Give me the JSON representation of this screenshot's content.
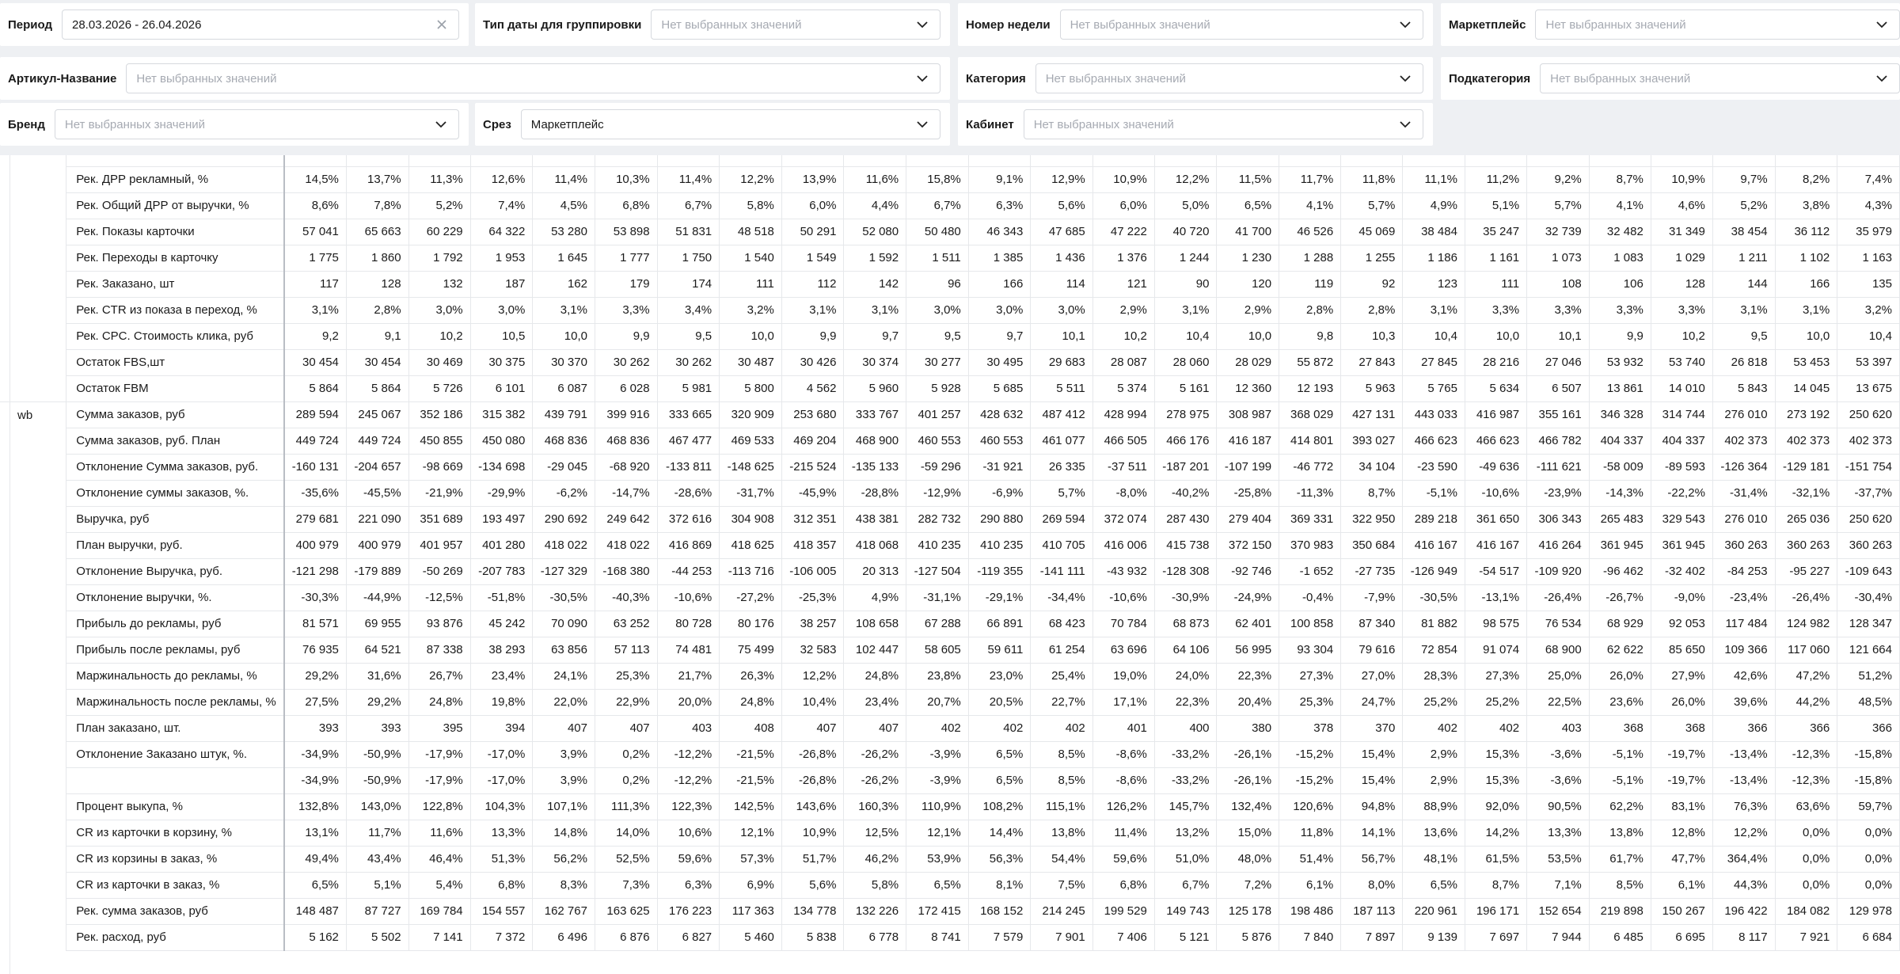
{
  "filters": {
    "period": {
      "label": "Период",
      "value": "28.03.2026 - 26.04.2026"
    },
    "date_type": {
      "label": "Тип даты для группировки",
      "placeholder": "Нет выбранных значений"
    },
    "week_number": {
      "label": "Номер недели",
      "placeholder": "Нет выбранных значений"
    },
    "marketplace": {
      "label": "Маркетплейс",
      "placeholder": "Нет выбранных значений"
    },
    "article": {
      "label": "Артикул-Название",
      "placeholder": "Нет выбранных значений"
    },
    "category": {
      "label": "Категория",
      "placeholder": "Нет выбранных значений"
    },
    "subcategory": {
      "label": "Подкатегория",
      "placeholder": "Нет выбранных значений"
    },
    "brand": {
      "label": "Бренд",
      "placeholder": "Нет выбранных значений"
    },
    "slice": {
      "label": "Срез",
      "value": "Маркетплейс"
    },
    "cabinet": {
      "label": "Кабинет",
      "placeholder": "Нет выбранных значений"
    }
  },
  "icons": {
    "clear": "close-icon",
    "dropdown": "chevron-down-icon"
  },
  "table": {
    "rows": [
      {
        "group": "",
        "name": "Рек. ДРР рекламный, %",
        "values": [
          "14,5%",
          "13,7%",
          "11,3%",
          "12,6%",
          "11,4%",
          "10,3%",
          "11,4%",
          "12,2%",
          "13,9%",
          "11,6%",
          "15,8%",
          "9,1%",
          "12,9%",
          "10,9%",
          "12,2%",
          "11,5%",
          "11,7%",
          "11,8%",
          "11,1%",
          "11,2%",
          "9,2%",
          "8,7%",
          "10,9%",
          "9,7%",
          "8,2%",
          "7,4%"
        ]
      },
      {
        "group": "",
        "name": "Рек. Общий ДРР от выручки, %",
        "values": [
          "8,6%",
          "7,8%",
          "5,2%",
          "7,4%",
          "4,5%",
          "6,8%",
          "6,7%",
          "5,8%",
          "6,0%",
          "4,4%",
          "6,7%",
          "6,3%",
          "5,6%",
          "6,0%",
          "5,0%",
          "6,5%",
          "4,1%",
          "5,7%",
          "4,9%",
          "5,1%",
          "5,7%",
          "4,1%",
          "4,6%",
          "5,2%",
          "3,8%",
          "4,3%"
        ]
      },
      {
        "group": "",
        "name": "Рек. Показы карточки",
        "values": [
          "57 041",
          "65 663",
          "60 229",
          "64 322",
          "53 280",
          "53 898",
          "51 831",
          "48 518",
          "50 291",
          "52 080",
          "50 480",
          "46 343",
          "47 685",
          "47 222",
          "40 720",
          "41 700",
          "46 526",
          "45 069",
          "38 484",
          "35 247",
          "32 739",
          "32 482",
          "31 349",
          "38 454",
          "36 112",
          "35 979"
        ]
      },
      {
        "group": "",
        "name": "Рек. Переходы в карточку",
        "values": [
          "1 775",
          "1 860",
          "1 792",
          "1 953",
          "1 645",
          "1 777",
          "1 750",
          "1 540",
          "1 549",
          "1 592",
          "1 511",
          "1 385",
          "1 436",
          "1 376",
          "1 244",
          "1 230",
          "1 288",
          "1 255",
          "1 186",
          "1 161",
          "1 073",
          "1 083",
          "1 029",
          "1 211",
          "1 102",
          "1 163"
        ]
      },
      {
        "group": "",
        "name": "Рек. Заказано, шт",
        "values": [
          "117",
          "128",
          "132",
          "187",
          "162",
          "179",
          "174",
          "111",
          "112",
          "142",
          "96",
          "166",
          "114",
          "121",
          "90",
          "120",
          "119",
          "92",
          "123",
          "111",
          "108",
          "106",
          "128",
          "144",
          "166",
          "135"
        ]
      },
      {
        "group": "",
        "name": "Рек. CTR из показа в переход, %",
        "values": [
          "3,1%",
          "2,8%",
          "3,0%",
          "3,0%",
          "3,1%",
          "3,3%",
          "3,4%",
          "3,2%",
          "3,1%",
          "3,1%",
          "3,0%",
          "3,0%",
          "3,0%",
          "2,9%",
          "3,1%",
          "2,9%",
          "2,8%",
          "2,8%",
          "3,1%",
          "3,3%",
          "3,3%",
          "3,3%",
          "3,3%",
          "3,1%",
          "3,1%",
          "3,2%"
        ]
      },
      {
        "group": "",
        "name": "Рек. CPC. Стоимость клика, руб",
        "values": [
          "9,2",
          "9,1",
          "10,2",
          "10,5",
          "10,0",
          "9,9",
          "9,5",
          "10,0",
          "9,9",
          "9,7",
          "9,5",
          "9,7",
          "10,1",
          "10,2",
          "10,4",
          "10,0",
          "9,8",
          "10,3",
          "10,4",
          "10,0",
          "10,1",
          "9,9",
          "10,2",
          "9,5",
          "10,0",
          "10,4"
        ]
      },
      {
        "group": "",
        "name": "Остаток FBS,шт",
        "values": [
          "30 454",
          "30 454",
          "30 469",
          "30 375",
          "30 370",
          "30 262",
          "30 262",
          "30 487",
          "30 426",
          "30 374",
          "30 277",
          "30 495",
          "29 683",
          "28 087",
          "28 060",
          "28 029",
          "55 872",
          "27 843",
          "27 845",
          "28 216",
          "27 046",
          "53 932",
          "53 740",
          "26 818",
          "53 453",
          "53 397"
        ]
      },
      {
        "group": "",
        "name": "Остаток FBM",
        "values": [
          "5 864",
          "5 864",
          "5 726",
          "6 101",
          "6 087",
          "6 028",
          "5 981",
          "5 800",
          "4 562",
          "5 960",
          "5 928",
          "5 685",
          "5 511",
          "5 374",
          "5 161",
          "12 360",
          "12 193",
          "5 963",
          "5 765",
          "5 634",
          "6 507",
          "13 861",
          "14 010",
          "5 843",
          "14 045",
          "13 675"
        ]
      },
      {
        "group": "wb",
        "name": "Сумма заказов, руб",
        "values": [
          "289 594",
          "245 067",
          "352 186",
          "315 382",
          "439 791",
          "399 916",
          "333 665",
          "320 909",
          "253 680",
          "333 767",
          "401 257",
          "428 632",
          "487 412",
          "428 994",
          "278 975",
          "308 987",
          "368 029",
          "427 131",
          "443 033",
          "416 987",
          "355 161",
          "346 328",
          "314 744",
          "276 010",
          "273 192",
          "250 620"
        ]
      },
      {
        "group": "",
        "name": "Сумма заказов, руб. План",
        "values": [
          "449 724",
          "449 724",
          "450 855",
          "450 080",
          "468 836",
          "468 836",
          "467 477",
          "469 533",
          "469 204",
          "468 900",
          "460 553",
          "460 553",
          "461 077",
          "466 505",
          "466 176",
          "416 187",
          "414 801",
          "393 027",
          "466 623",
          "466 623",
          "466 782",
          "404 337",
          "404 337",
          "402 373",
          "402 373",
          "402 373"
        ]
      },
      {
        "group": "",
        "name": "Отклонение Сумма заказов, руб.",
        "values": [
          "-160 131",
          "-204 657",
          "-98 669",
          "-134 698",
          "-29 045",
          "-68 920",
          "-133 811",
          "-148 625",
          "-215 524",
          "-135 133",
          "-59 296",
          "-31 921",
          "26 335",
          "-37 511",
          "-187 201",
          "-107 199",
          "-46 772",
          "34 104",
          "-23 590",
          "-49 636",
          "-111 621",
          "-58 009",
          "-89 593",
          "-126 364",
          "-129 181",
          "-151 754"
        ]
      },
      {
        "group": "",
        "name": "Отклонение суммы заказов, %.",
        "values": [
          "-35,6%",
          "-45,5%",
          "-21,9%",
          "-29,9%",
          "-6,2%",
          "-14,7%",
          "-28,6%",
          "-31,7%",
          "-45,9%",
          "-28,8%",
          "-12,9%",
          "-6,9%",
          "5,7%",
          "-8,0%",
          "-40,2%",
          "-25,8%",
          "-11,3%",
          "8,7%",
          "-5,1%",
          "-10,6%",
          "-23,9%",
          "-14,3%",
          "-22,2%",
          "-31,4%",
          "-32,1%",
          "-37,7%"
        ]
      },
      {
        "group": "",
        "name": "Выручка, руб",
        "values": [
          "279 681",
          "221 090",
          "351 689",
          "193 497",
          "290 692",
          "249 642",
          "372 616",
          "304 908",
          "312 351",
          "438 381",
          "282 732",
          "290 880",
          "269 594",
          "372 074",
          "287 430",
          "279 404",
          "369 331",
          "322 950",
          "289 218",
          "361 650",
          "306 343",
          "265 483",
          "329 543",
          "276 010",
          "265 036",
          "250 620"
        ]
      },
      {
        "group": "",
        "name": "План выручки, руб.",
        "values": [
          "400 979",
          "400 979",
          "401 957",
          "401 280",
          "418 022",
          "418 022",
          "416 869",
          "418 625",
          "418 357",
          "418 068",
          "410 235",
          "410 235",
          "410 705",
          "416 006",
          "415 738",
          "372 150",
          "370 983",
          "350 684",
          "416 167",
          "416 167",
          "416 264",
          "361 945",
          "361 945",
          "360 263",
          "360 263",
          "360 263"
        ]
      },
      {
        "group": "",
        "name": "Отклонение Выручка, руб.",
        "values": [
          "-121 298",
          "-179 889",
          "-50 269",
          "-207 783",
          "-127 329",
          "-168 380",
          "-44 253",
          "-113 716",
          "-106 005",
          "20 313",
          "-127 504",
          "-119 355",
          "-141 111",
          "-43 932",
          "-128 308",
          "-92 746",
          "-1 652",
          "-27 735",
          "-126 949",
          "-54 517",
          "-109 920",
          "-96 462",
          "-32 402",
          "-84 253",
          "-95 227",
          "-109 643"
        ]
      },
      {
        "group": "",
        "name": "Отклонение выручки, %.",
        "values": [
          "-30,3%",
          "-44,9%",
          "-12,5%",
          "-51,8%",
          "-30,5%",
          "-40,3%",
          "-10,6%",
          "-27,2%",
          "-25,3%",
          "4,9%",
          "-31,1%",
          "-29,1%",
          "-34,4%",
          "-10,6%",
          "-30,9%",
          "-24,9%",
          "-0,4%",
          "-7,9%",
          "-30,5%",
          "-13,1%",
          "-26,4%",
          "-26,7%",
          "-9,0%",
          "-23,4%",
          "-26,4%",
          "-30,4%"
        ]
      },
      {
        "group": "",
        "name": "Прибыль до рекламы, руб",
        "values": [
          "81 571",
          "69 955",
          "93 876",
          "45 242",
          "70 090",
          "63 252",
          "80 728",
          "80 176",
          "38 257",
          "108 658",
          "67 288",
          "66 891",
          "68 423",
          "70 784",
          "68 873",
          "62 401",
          "100 858",
          "87 340",
          "81 882",
          "98 575",
          "76 534",
          "68 929",
          "92 053",
          "117 484",
          "124 982",
          "128 347"
        ]
      },
      {
        "group": "",
        "name": "Прибыль после рекламы, руб",
        "values": [
          "76 935",
          "64 521",
          "87 338",
          "38 293",
          "63 856",
          "57 113",
          "74 481",
          "75 499",
          "32 583",
          "102 447",
          "58 605",
          "59 611",
          "61 254",
          "63 696",
          "64 106",
          "56 995",
          "93 304",
          "79 616",
          "72 854",
          "91 074",
          "68 900",
          "62 622",
          "85 650",
          "109 366",
          "117 060",
          "121 664"
        ]
      },
      {
        "group": "",
        "name": "Маржинальность до рекламы, %",
        "values": [
          "29,2%",
          "31,6%",
          "26,7%",
          "23,4%",
          "24,1%",
          "25,3%",
          "21,7%",
          "26,3%",
          "12,2%",
          "24,8%",
          "23,8%",
          "23,0%",
          "25,4%",
          "19,0%",
          "24,0%",
          "22,3%",
          "27,3%",
          "27,0%",
          "28,3%",
          "27,3%",
          "25,0%",
          "26,0%",
          "27,9%",
          "42,6%",
          "47,2%",
          "51,2%"
        ]
      },
      {
        "group": "",
        "name": "Маржинальность после рекламы, %",
        "values": [
          "27,5%",
          "29,2%",
          "24,8%",
          "19,8%",
          "22,0%",
          "22,9%",
          "20,0%",
          "24,8%",
          "10,4%",
          "23,4%",
          "20,7%",
          "20,5%",
          "22,7%",
          "17,1%",
          "22,3%",
          "20,4%",
          "25,3%",
          "24,7%",
          "25,2%",
          "25,2%",
          "22,5%",
          "23,6%",
          "26,0%",
          "39,6%",
          "44,2%",
          "48,5%"
        ]
      },
      {
        "group": "",
        "name": "План заказано, шт.",
        "values": [
          "393",
          "393",
          "395",
          "394",
          "407",
          "407",
          "403",
          "408",
          "407",
          "407",
          "402",
          "402",
          "402",
          "401",
          "400",
          "380",
          "378",
          "370",
          "402",
          "402",
          "403",
          "368",
          "368",
          "366",
          "366",
          "366"
        ]
      },
      {
        "group": "",
        "name": "Отклонение Заказано штук, %.",
        "values": [
          "-34,9%",
          "-50,9%",
          "-17,9%",
          "-17,0%",
          "3,9%",
          "0,2%",
          "-12,2%",
          "-21,5%",
          "-26,8%",
          "-26,2%",
          "-3,9%",
          "6,5%",
          "8,5%",
          "-8,6%",
          "-33,2%",
          "-26,1%",
          "-15,2%",
          "15,4%",
          "2,9%",
          "15,3%",
          "-3,6%",
          "-5,1%",
          "-19,7%",
          "-13,4%",
          "-12,3%",
          "-15,8%"
        ]
      },
      {
        "group": "",
        "name": "",
        "values": [
          "-34,9%",
          "-50,9%",
          "-17,9%",
          "-17,0%",
          "3,9%",
          "0,2%",
          "-12,2%",
          "-21,5%",
          "-26,8%",
          "-26,2%",
          "-3,9%",
          "6,5%",
          "8,5%",
          "-8,6%",
          "-33,2%",
          "-26,1%",
          "-15,2%",
          "15,4%",
          "2,9%",
          "15,3%",
          "-3,6%",
          "-5,1%",
          "-19,7%",
          "-13,4%",
          "-12,3%",
          "-15,8%"
        ]
      },
      {
        "group": "",
        "name": "Процент выкупа, %",
        "values": [
          "132,8%",
          "143,0%",
          "122,8%",
          "104,3%",
          "107,1%",
          "111,3%",
          "122,3%",
          "142,5%",
          "143,6%",
          "160,3%",
          "110,9%",
          "108,2%",
          "115,1%",
          "126,2%",
          "145,7%",
          "132,4%",
          "120,6%",
          "94,8%",
          "88,9%",
          "92,0%",
          "90,5%",
          "62,2%",
          "83,1%",
          "76,3%",
          "63,6%",
          "59,7%"
        ]
      },
      {
        "group": "",
        "name": "CR из карточки в корзину, %",
        "values": [
          "13,1%",
          "11,7%",
          "11,6%",
          "13,3%",
          "14,8%",
          "14,0%",
          "10,6%",
          "12,1%",
          "10,9%",
          "12,5%",
          "12,1%",
          "14,4%",
          "13,8%",
          "11,4%",
          "13,2%",
          "15,0%",
          "11,8%",
          "14,1%",
          "13,6%",
          "14,2%",
          "13,3%",
          "13,8%",
          "12,8%",
          "12,2%",
          "0,0%",
          "0,0%"
        ]
      },
      {
        "group": "",
        "name": "CR из корзины в заказ, %",
        "values": [
          "49,4%",
          "43,4%",
          "46,4%",
          "51,3%",
          "56,2%",
          "52,5%",
          "59,6%",
          "57,3%",
          "51,7%",
          "46,2%",
          "53,9%",
          "56,3%",
          "54,4%",
          "59,6%",
          "51,0%",
          "48,0%",
          "51,4%",
          "56,7%",
          "48,1%",
          "61,5%",
          "53,5%",
          "61,7%",
          "47,7%",
          "364,4%",
          "0,0%",
          "0,0%"
        ]
      },
      {
        "group": "",
        "name": "CR из карточки в заказ, %",
        "values": [
          "6,5%",
          "5,1%",
          "5,4%",
          "6,8%",
          "8,3%",
          "7,3%",
          "6,3%",
          "6,9%",
          "5,6%",
          "5,8%",
          "6,5%",
          "8,1%",
          "7,5%",
          "6,8%",
          "6,7%",
          "7,2%",
          "6,1%",
          "8,0%",
          "6,5%",
          "8,7%",
          "7,1%",
          "8,5%",
          "6,1%",
          "44,3%",
          "0,0%",
          "0,0%"
        ]
      },
      {
        "group": "",
        "name": "Рек. сумма заказов, руб",
        "values": [
          "148 487",
          "87 727",
          "169 784",
          "154 557",
          "162 767",
          "163 625",
          "176 223",
          "117 363",
          "134 778",
          "132 226",
          "172 415",
          "168 152",
          "214 245",
          "199 529",
          "149 743",
          "125 178",
          "198 486",
          "187 113",
          "220 961",
          "196 171",
          "152 654",
          "219 898",
          "150 267",
          "196 422",
          "184 082",
          "129 978"
        ]
      },
      {
        "group": "",
        "name": "Рек. расход, руб",
        "values": [
          "5 162",
          "5 502",
          "7 141",
          "7 372",
          "6 496",
          "6 876",
          "6 827",
          "5 460",
          "5 838",
          "6 778",
          "8 741",
          "7 579",
          "7 901",
          "7 406",
          "5 121",
          "5 876",
          "7 840",
          "7 897",
          "9 139",
          "7 697",
          "7 944",
          "6 485",
          "6 695",
          "8 117",
          "7 921",
          "6 684"
        ]
      }
    ]
  }
}
